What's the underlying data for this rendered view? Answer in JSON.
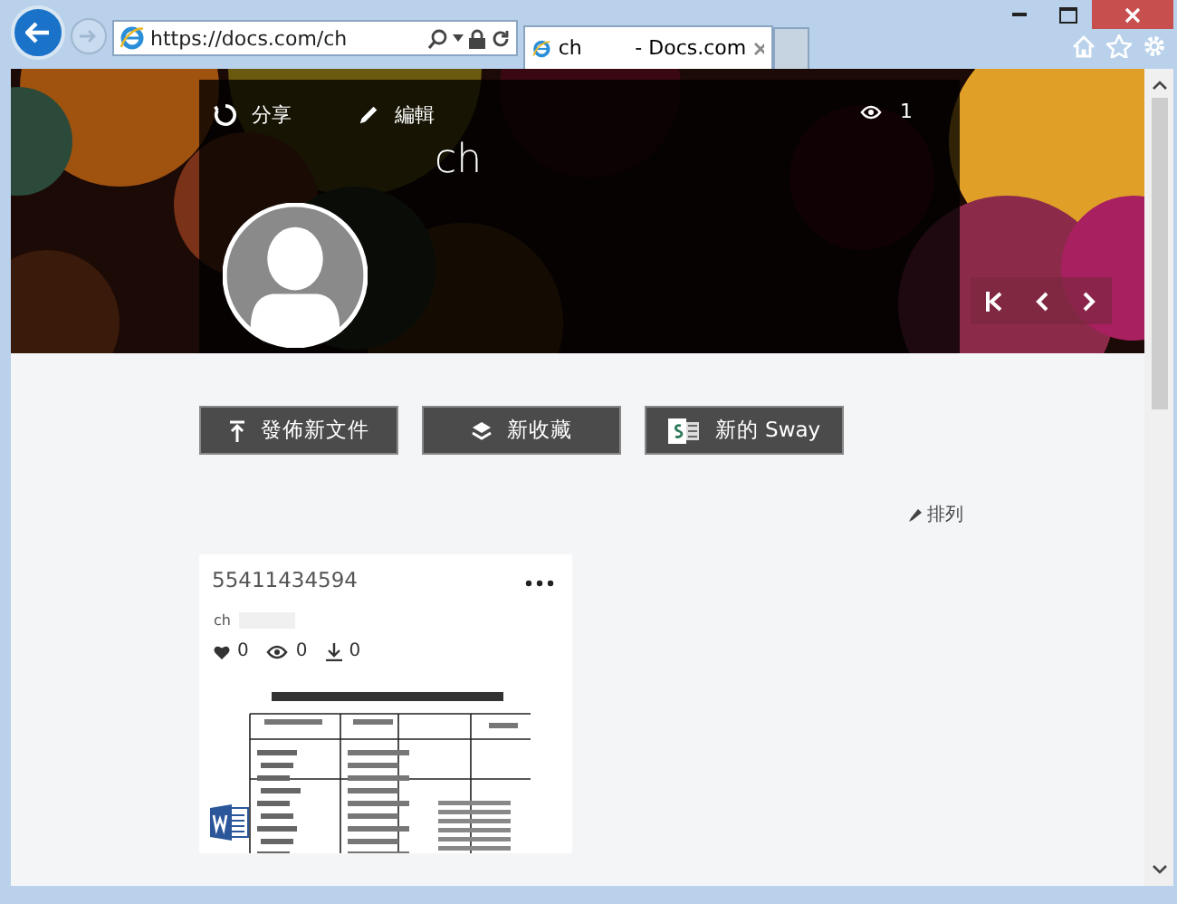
{
  "browser": {
    "address": "https://docs.com/ch",
    "tab_title": "ch",
    "tab_site": "- Docs.com"
  },
  "profile": {
    "actions": [
      {
        "kind": "share",
        "label": "分享"
      },
      {
        "kind": "edit",
        "label": "編輯"
      }
    ],
    "views": "1",
    "name": "ch"
  },
  "buttons": [
    {
      "kind": "upload",
      "label": "發佈新文件"
    },
    {
      "kind": "collection",
      "label": "新收藏"
    },
    {
      "kind": "sway",
      "label": "新的 Sway"
    }
  ],
  "sort": {
    "label": "排列"
  },
  "card": {
    "title": "55411434594",
    "author": "ch",
    "stats": [
      {
        "kind": "like",
        "value": "0"
      },
      {
        "kind": "view",
        "value": "0"
      },
      {
        "kind": "download",
        "value": "0"
      }
    ]
  }
}
